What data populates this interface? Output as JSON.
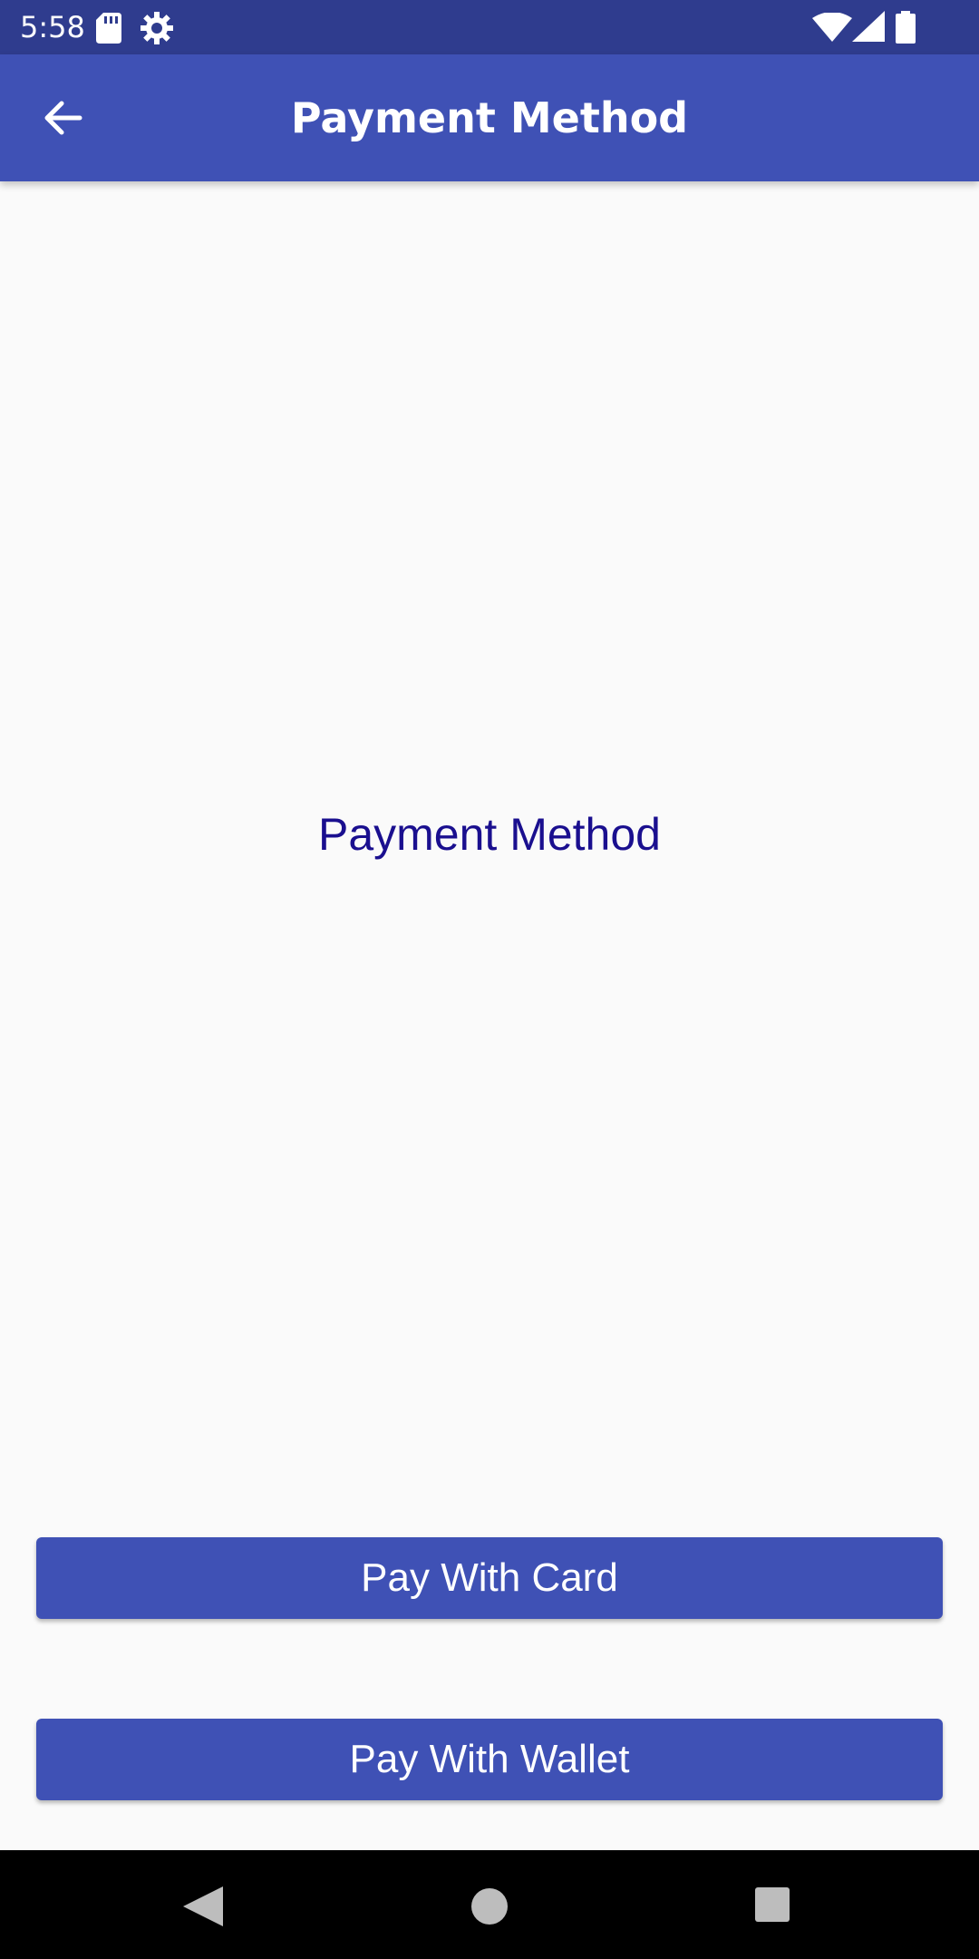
{
  "status_bar": {
    "time": "5:58",
    "icons": [
      "sd-card-icon",
      "gear-icon",
      "wifi-icon",
      "cell-signal-icon",
      "battery-icon"
    ]
  },
  "app_bar": {
    "title": "Payment Method",
    "back_icon": "arrow-back-icon"
  },
  "main": {
    "label": "Payment Method"
  },
  "buttons": {
    "pay_with_card": "Pay With Card",
    "pay_with_wallet": "Pay With Wallet"
  },
  "nav_bar": {
    "icons": [
      "nav-back-icon",
      "nav-home-icon",
      "nav-recents-icon"
    ]
  },
  "colors": {
    "status_bar": "#2f3c8e",
    "primary": "#3f51b5",
    "label_text": "#1a0f8f",
    "background": "#fafafa",
    "nav_bar": "#000000"
  }
}
